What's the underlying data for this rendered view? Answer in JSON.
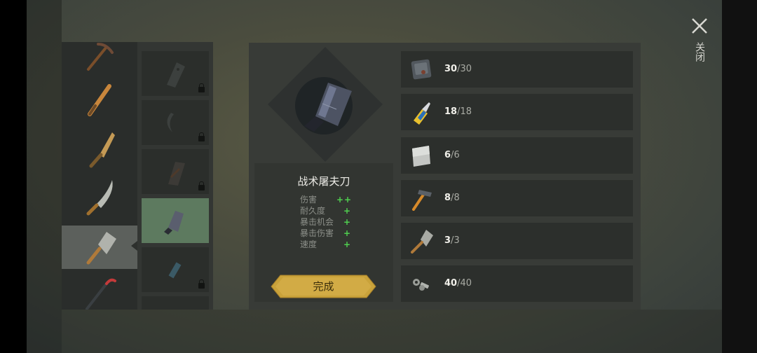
{
  "close": {
    "label": "关闭"
  },
  "categories": [
    {
      "icon": "pickaxe-icon"
    },
    {
      "icon": "baseball-bat-icon"
    },
    {
      "icon": "plank-club-icon"
    },
    {
      "icon": "machete-icon"
    },
    {
      "icon": "cleaver-icon",
      "selected": true
    },
    {
      "icon": "crowbar-icon"
    }
  ],
  "recipes": [
    {
      "icon": "blade-icon",
      "locked": true
    },
    {
      "icon": "sickle-icon",
      "locked": true
    },
    {
      "icon": "rusty-blade-icon",
      "locked": true
    },
    {
      "icon": "tactical-cleaver-icon",
      "locked": false,
      "selected": true
    },
    {
      "icon": "knife-icon",
      "locked": true
    },
    {
      "icon": "partial-item-icon",
      "locked": true
    }
  ],
  "item": {
    "name": "战术屠夫刀",
    "icon": "tactical-cleaver-icon",
    "stats": [
      {
        "label": "伤害",
        "value": "++"
      },
      {
        "label": "耐久度",
        "value": "+"
      },
      {
        "label": "暴击机会",
        "value": "+"
      },
      {
        "label": "暴击伤害",
        "value": "+"
      },
      {
        "label": "速度",
        "value": "+"
      }
    ],
    "craft_button": "完成"
  },
  "materials": [
    {
      "icon": "metal-plate-icon",
      "have": "30",
      "need": "30"
    },
    {
      "icon": "glue-icon",
      "have": "18",
      "need": "18"
    },
    {
      "icon": "sheet-metal-icon",
      "have": "6",
      "need": "6"
    },
    {
      "icon": "hammer-icon",
      "have": "8",
      "need": "8"
    },
    {
      "icon": "cleaver-icon",
      "have": "3",
      "need": "3"
    },
    {
      "icon": "nuts-bolts-icon",
      "have": "40",
      "need": "40"
    }
  ],
  "colors": {
    "selected_category": "#5c605c",
    "selected_recipe": "#5d7a5f",
    "stat_plus": "#4fd04f",
    "button_gold": "#c9a23a"
  }
}
